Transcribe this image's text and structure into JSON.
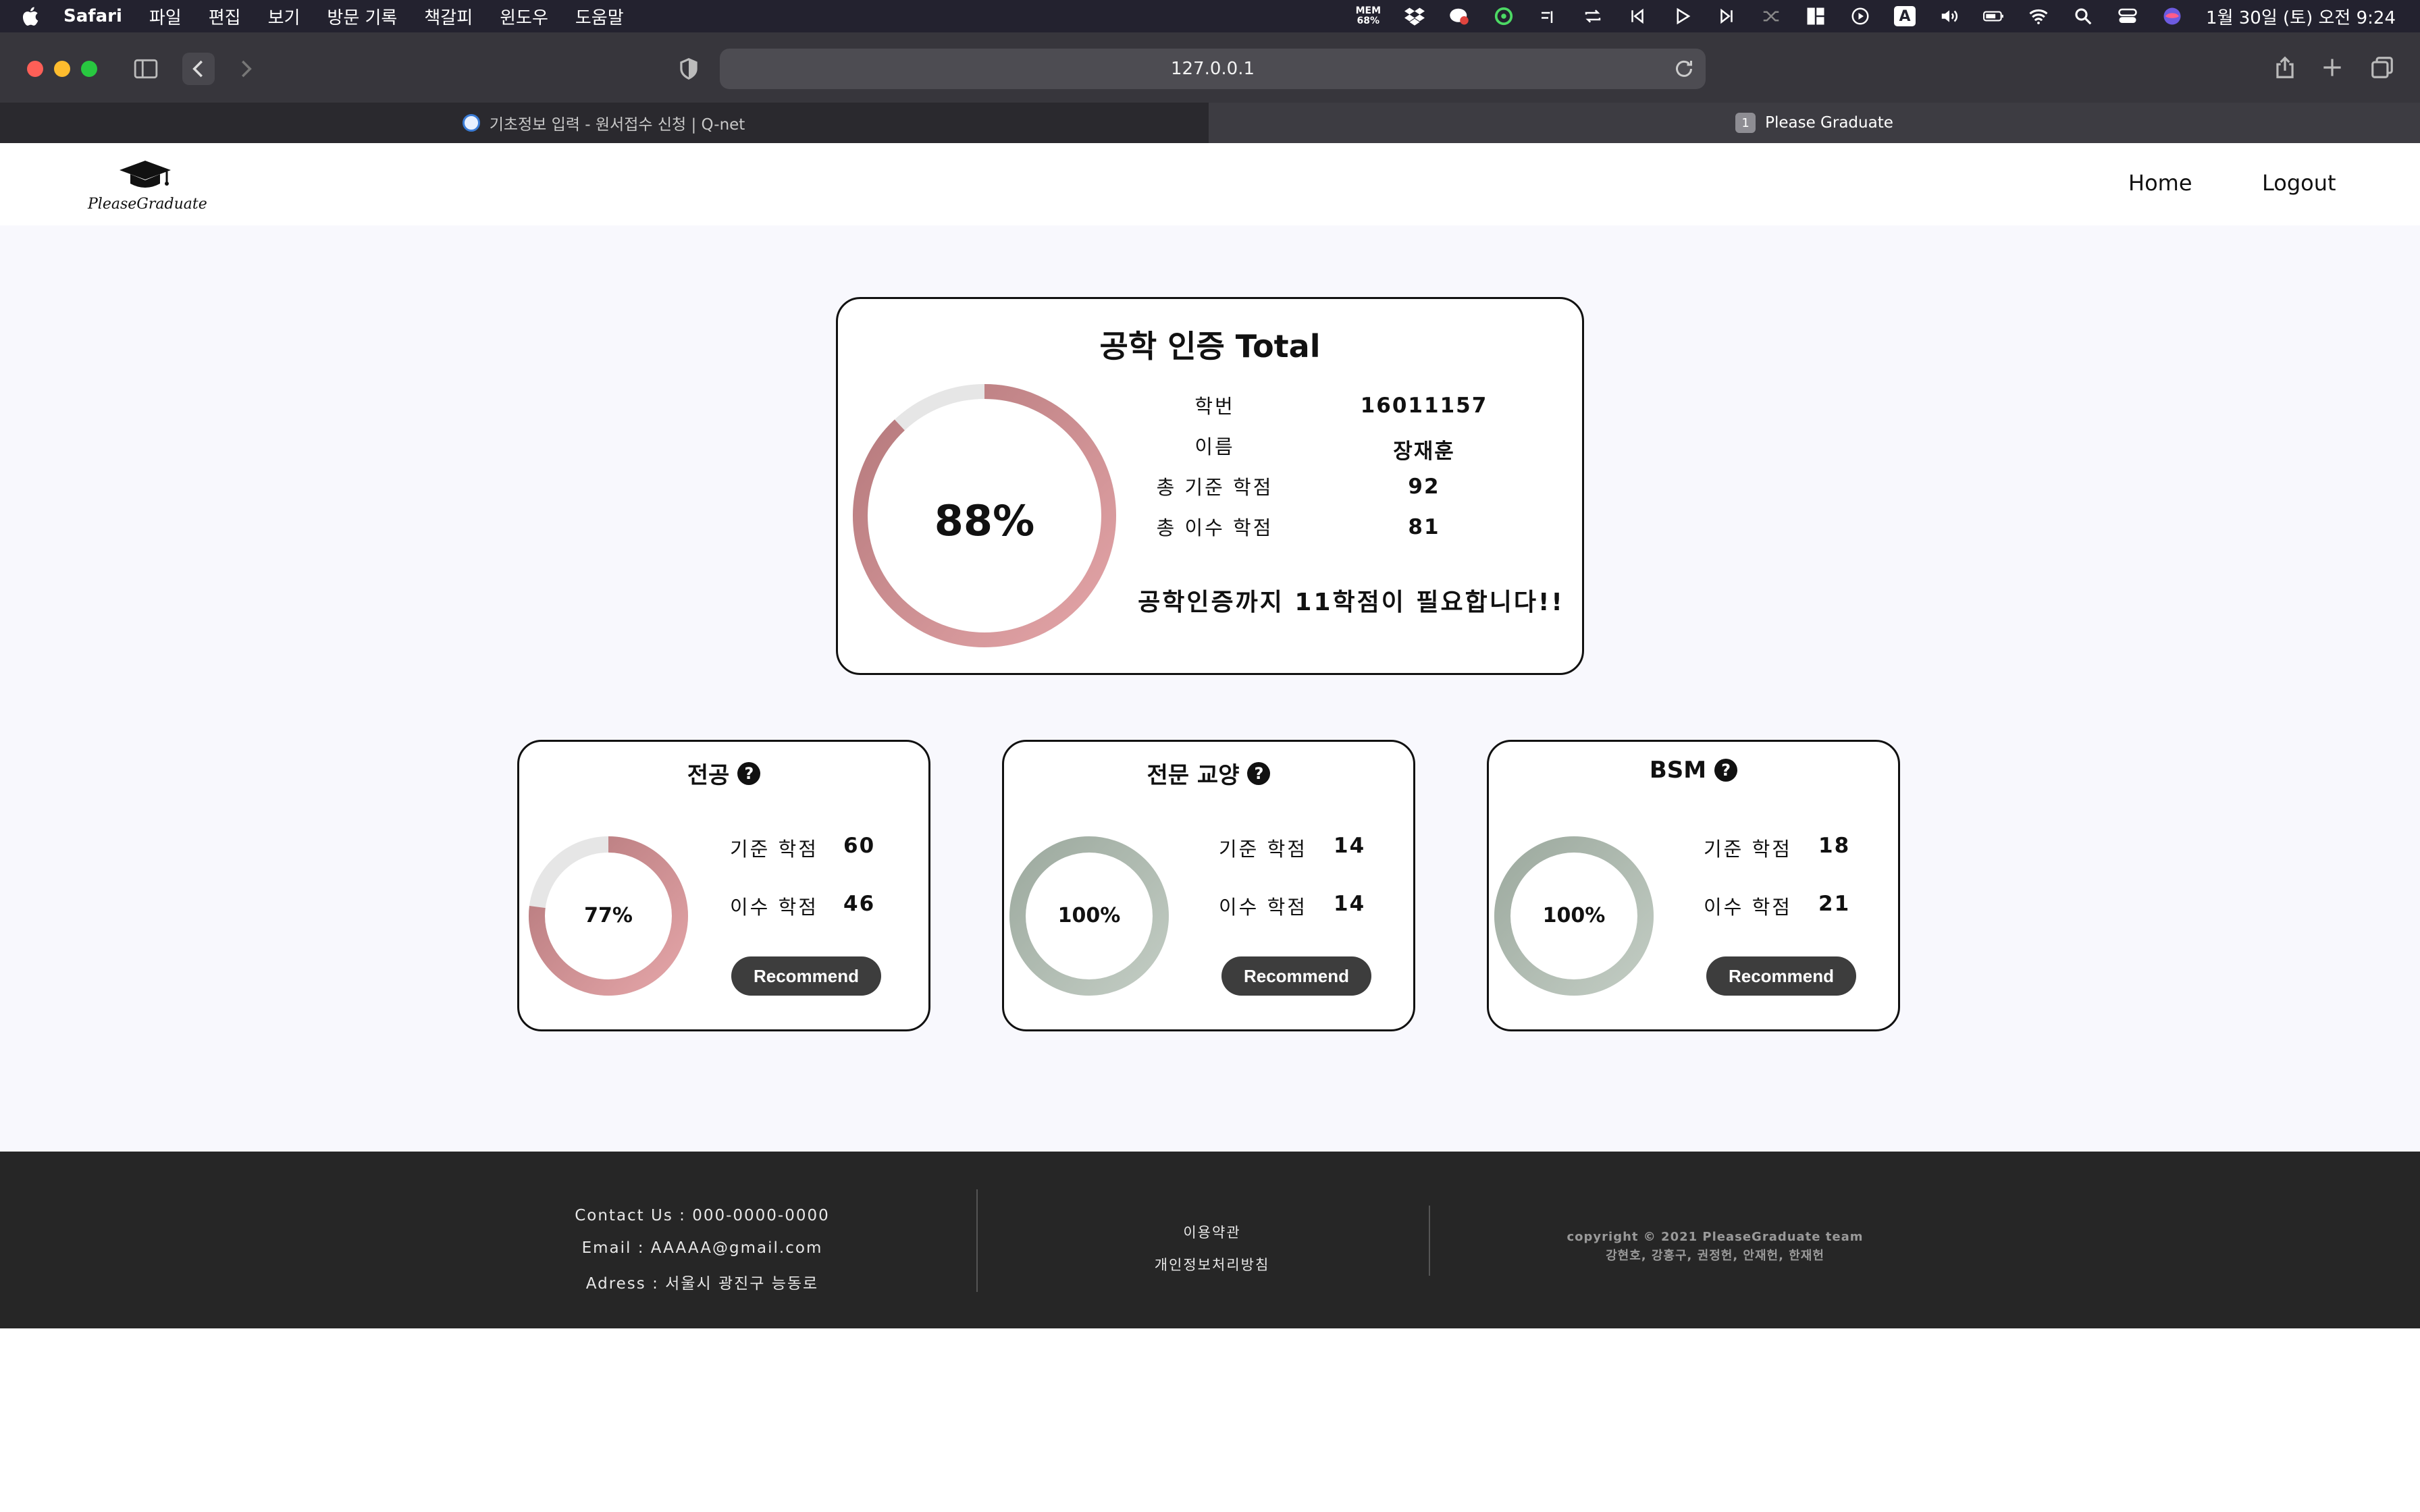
{
  "menubar": {
    "app": "Safari",
    "items": [
      "파일",
      "편집",
      "보기",
      "방문 기록",
      "책갈피",
      "윈도우",
      "도움말"
    ],
    "mem_label": "MEM",
    "mem_value": "68%",
    "input_method": "A",
    "clock": "1월 30일 (토) 오전 9:24"
  },
  "browser": {
    "url": "127.0.0.1",
    "tabs": [
      {
        "title": "기초정보 입력 - 원서접수 신청 | Q-net"
      },
      {
        "title": "Please Graduate",
        "badge": "1"
      }
    ]
  },
  "header": {
    "logo_text": "PleaseGraduate",
    "nav": {
      "home": "Home",
      "logout": "Logout"
    }
  },
  "total": {
    "title": "공학 인증 Total",
    "percent": 88,
    "percent_label": "88%",
    "labels": {
      "student_id": "학번",
      "name": "이름",
      "required": "총 기준 학점",
      "earned": "총 이수 학점"
    },
    "values": {
      "student_id": "16011157",
      "name": "장재훈",
      "required": "92",
      "earned": "81"
    },
    "message": "공학인증까지 11학점이 필요합니다!!"
  },
  "categories": [
    {
      "title": "전공",
      "percent": 77,
      "percent_label": "77%",
      "required_label": "기준 학점",
      "required": "60",
      "earned_label": "이수 학점",
      "earned": "46",
      "button": "Recommend",
      "color": "red"
    },
    {
      "title": "전문 교양",
      "percent": 100,
      "percent_label": "100%",
      "required_label": "기준 학점",
      "required": "14",
      "earned_label": "이수 학점",
      "earned": "14",
      "button": "Recommend",
      "color": "green"
    },
    {
      "title": "BSM",
      "percent": 100,
      "percent_label": "100%",
      "required_label": "기준 학점",
      "required": "18",
      "earned_label": "이수 학점",
      "earned": "21",
      "button": "Recommend",
      "color": "green"
    }
  ],
  "help_glyph": "?",
  "footer": {
    "contact": "Contact Us : 000-0000-0000",
    "email": "Email : AAAAA@gmail.com",
    "address": "Adress : 서울시 광진구 능동로",
    "terms": "이용약관",
    "privacy": "개인정보처리방침",
    "copyright": "copyright © 2021 PleaseGraduate team",
    "members": "강현호, 강홍구, 권정헌, 안재헌, 한재헌"
  },
  "colors": {
    "ring_red_start": "#e4a5a8",
    "ring_red_end": "#b4787b",
    "ring_green_start": "#c2ccc3",
    "ring_green_end": "#9daa9f",
    "ring_track": "#e6e6e6",
    "content_bg": "#f8f8fd",
    "footer_bg": "#262626"
  }
}
